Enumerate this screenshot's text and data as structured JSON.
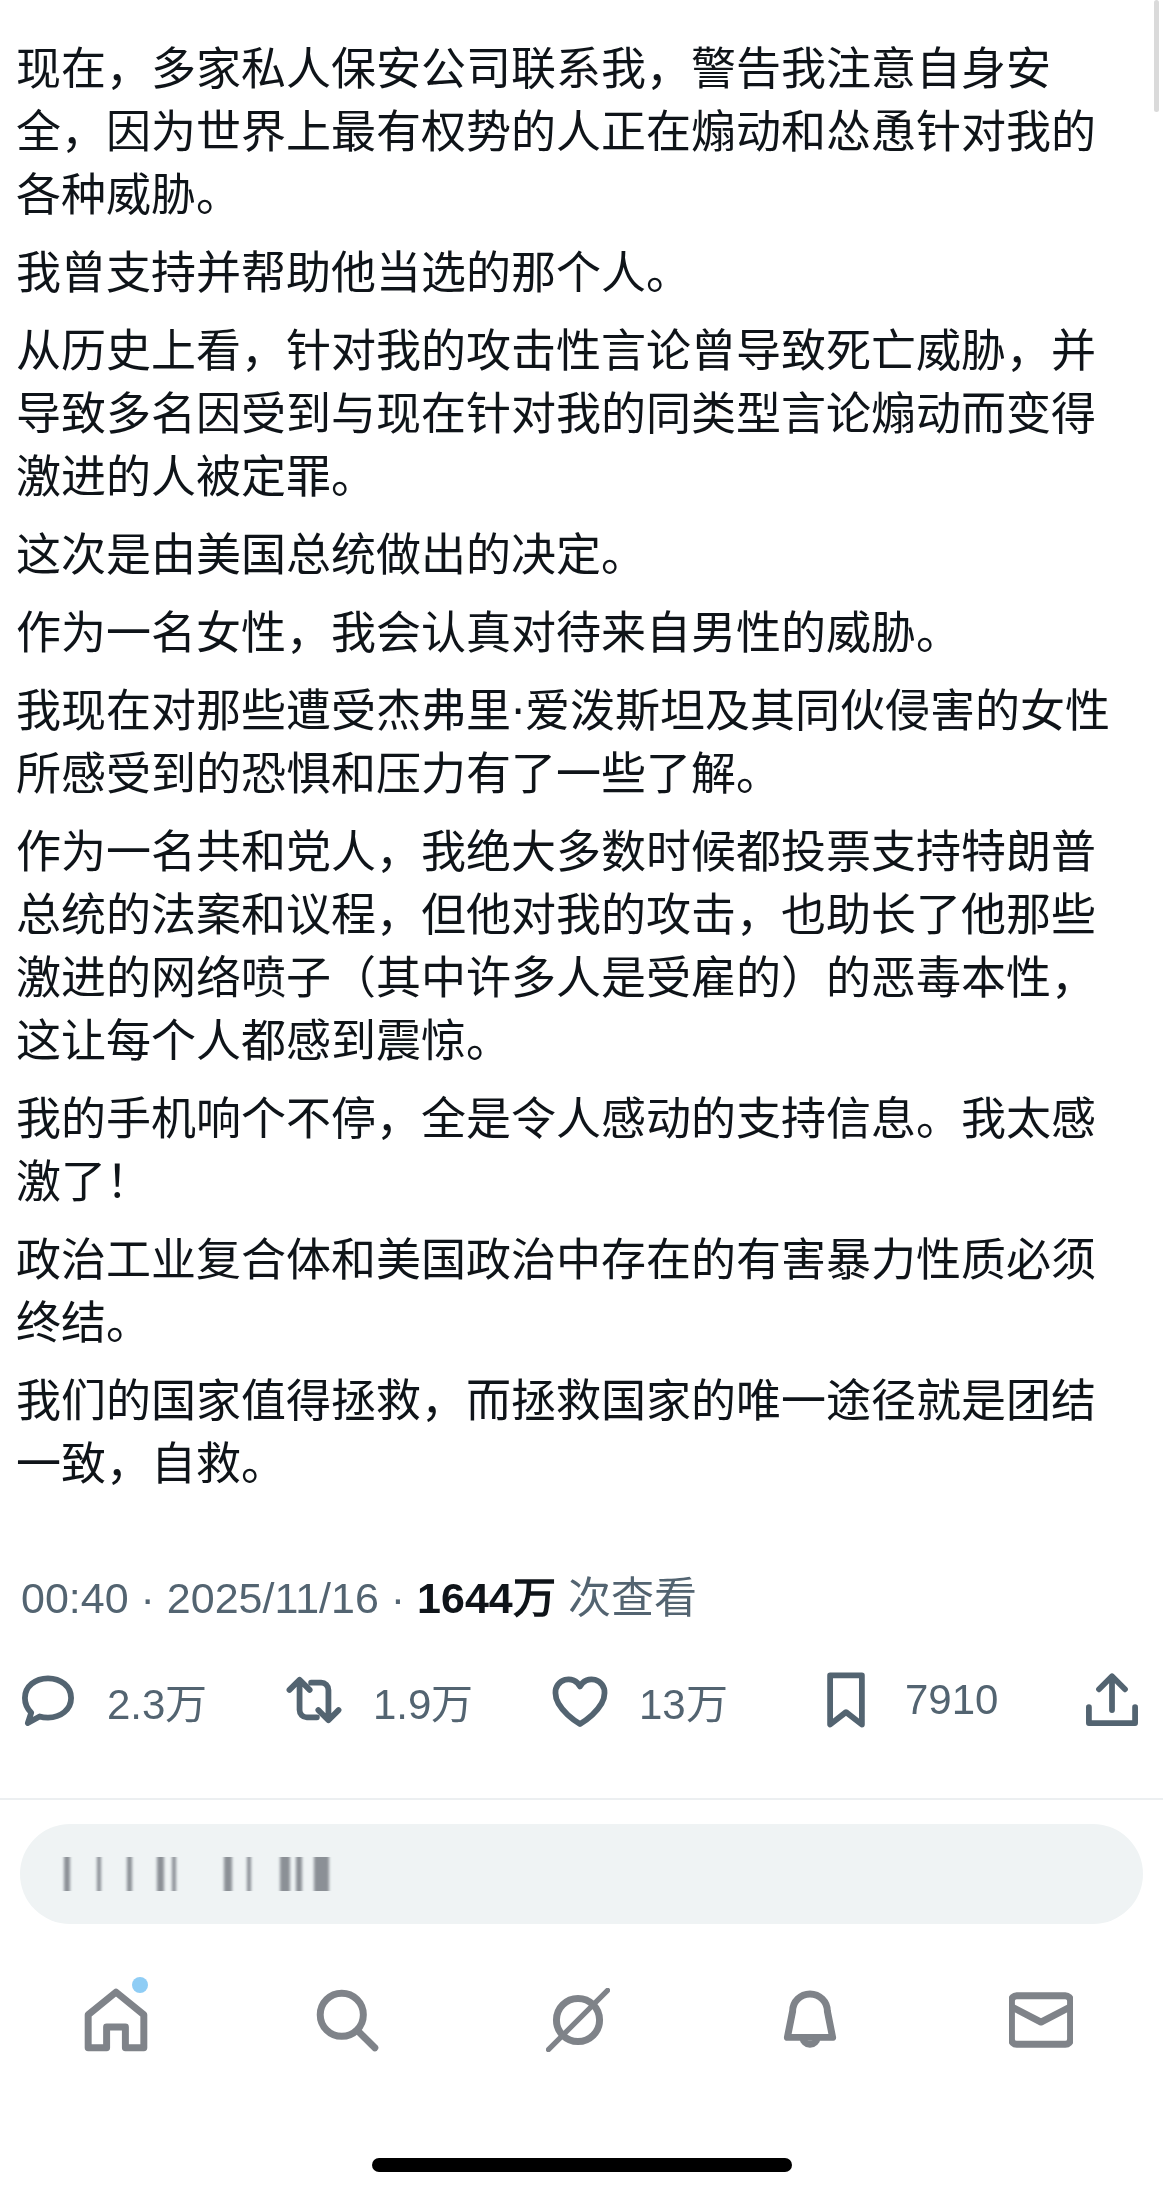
{
  "post": {
    "paragraphs": [
      "现在，多家私人保安公司联系我，警告我注意自身安全，因为世界上最有权势的人正在煽动和怂恿针对我的各种威胁。",
      "我曾支持并帮助他当选的那个人。",
      "从历史上看，针对我的攻击性言论曾导致死亡威胁，并导致多名因受到与现在针对我的同类型言论煽动而变得激进的人被定罪。",
      "这次是由美国总统做出的决定。",
      "作为一名女性，我会认真对待来自男性的威胁。",
      "我现在对那些遭受杰弗里·爱泼斯坦及其同伙侵害的女性所感受到的恐惧和压力有了一些了解。",
      "作为一名共和党人，我绝大多数时候都投票支持特朗普总统的法案和议程，但他对我的攻击，也助长了他那些激进的网络喷子（其中许多人是受雇的）的恶毒本性，这让每个人都感到震惊。",
      "我的手机响个不停，全是令人感动的支持信息。我太感激了！",
      "政治工业复合体和美国政治中存在的有害暴力性质必须终结。",
      "我们的国家值得拯救，而拯救国家的唯一途径就是团结一致，自救。"
    ]
  },
  "meta": "00:40 · 2025/11/16 · **1644万** 次查看",
  "actions": [
    {
      "kind": "reply",
      "count": "2.3万"
    },
    {
      "kind": "repost",
      "count": "1.9万"
    },
    {
      "kind": "like",
      "count": "13万"
    },
    {
      "kind": "bookmark",
      "count": "7910"
    },
    {
      "kind": "share"
    }
  ],
  "reply_field": {
    "placeholder_blurred": true
  },
  "nav": [
    {
      "kind": "home",
      "unread": true
    },
    {
      "kind": "search",
      "unread": false
    },
    {
      "kind": "circle_slash",
      "unread": false
    },
    {
      "kind": "notifications",
      "unread": false
    },
    {
      "kind": "messages",
      "unread": false
    }
  ]
}
